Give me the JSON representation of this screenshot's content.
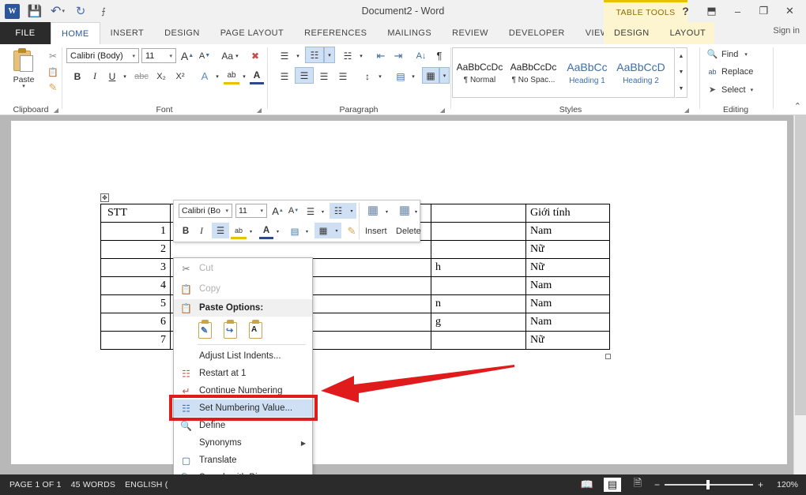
{
  "titlebar": {
    "document_title": "Document2 - Word",
    "quick_access": [
      {
        "name": "word-logo",
        "label": "W"
      },
      {
        "name": "save-icon",
        "label": "💾"
      },
      {
        "name": "undo-icon",
        "label": "↶"
      },
      {
        "name": "redo-icon",
        "label": "↻"
      },
      {
        "name": "customize-qat-icon",
        "label": "⨍"
      }
    ],
    "contextual_tab_title": "TABLE TOOLS",
    "window_buttons": [
      {
        "name": "help-button",
        "label": "?"
      },
      {
        "name": "ribbon-display-options-button",
        "label": "⬒"
      },
      {
        "name": "minimize-button",
        "label": "–"
      },
      {
        "name": "restore-button",
        "label": "❐"
      },
      {
        "name": "close-button",
        "label": "✕"
      }
    ]
  },
  "tabs": {
    "file_label": "FILE",
    "items": [
      {
        "label": "HOME",
        "active": true
      },
      {
        "label": "INSERT",
        "active": false
      },
      {
        "label": "DESIGN",
        "active": false
      },
      {
        "label": "PAGE LAYOUT",
        "active": false
      },
      {
        "label": "REFERENCES",
        "active": false
      },
      {
        "label": "MAILINGS",
        "active": false
      },
      {
        "label": "REVIEW",
        "active": false
      },
      {
        "label": "DEVELOPER",
        "active": false
      },
      {
        "label": "VIEW",
        "active": false
      }
    ],
    "table_tools_tabs": [
      {
        "label": "DESIGN"
      },
      {
        "label": "LAYOUT"
      }
    ],
    "sign_in": "Sign in"
  },
  "ribbon": {
    "groups": [
      {
        "name": "clipboard",
        "label": "Clipboard"
      },
      {
        "name": "font",
        "label": "Font"
      },
      {
        "name": "paragraph",
        "label": "Paragraph"
      },
      {
        "name": "styles",
        "label": "Styles"
      },
      {
        "name": "editing",
        "label": "Editing"
      }
    ],
    "clipboard": {
      "paste_label": "Paste",
      "cut_label": "✂",
      "copy_label": "❐",
      "format_painter_label": "🖌"
    },
    "font": {
      "font_name": "Calibri (Body)",
      "font_size": "11",
      "grow_font": "A",
      "shrink_font": "A",
      "change_case": "Aa",
      "clear_formatting": "🖍",
      "bold": "B",
      "italic": "I",
      "underline": "U",
      "strikethrough": "abc",
      "subscript": "X₂",
      "superscript": "X²",
      "text_effects": "A",
      "highlight": "ab",
      "font_color": "A"
    },
    "paragraph": {
      "bullets": "☰",
      "numbering": "☷",
      "multilevel": "☵",
      "decrease_indent": "⇤",
      "increase_indent": "⇥",
      "sort": "A↓",
      "show_marks": "¶",
      "align_left": "☰",
      "align_center": "☰",
      "align_right": "☰",
      "justify": "☰",
      "line_spacing": "↕",
      "shading": "▤",
      "borders": "▦"
    },
    "styles": {
      "items": [
        {
          "preview": "AaBbCcDc",
          "name": "¶ Normal",
          "heading": false
        },
        {
          "preview": "AaBbCcDc",
          "name": "¶ No Spac...",
          "heading": false
        },
        {
          "preview": "AaBbCс",
          "name": "Heading 1",
          "heading": true
        },
        {
          "preview": "AaBbCcD",
          "name": "Heading 2",
          "heading": true
        }
      ]
    },
    "editing": {
      "find": "Find",
      "replace": "Replace",
      "select": "Select",
      "find_icon": "🔍",
      "replace_icon": "ab",
      "select_icon": "➤"
    },
    "collapse_icon": "⌃"
  },
  "document": {
    "table": {
      "headers": [
        "STT",
        "",
        "",
        "Giới tính"
      ],
      "rows": [
        {
          "stt": "1",
          "name": "",
          "extra": "",
          "sex": "Nam"
        },
        {
          "stt": "2",
          "name": "",
          "extra": "",
          "sex": "Nữ"
        },
        {
          "stt": "3",
          "name": "",
          "extra": "h",
          "sex": "Nữ"
        },
        {
          "stt": "4",
          "name": "",
          "extra": "",
          "sex": "Nam"
        },
        {
          "stt": "5",
          "name": "",
          "extra": "n",
          "sex": "Nam"
        },
        {
          "stt": "6",
          "name": "",
          "extra": "g",
          "sex": "Nam"
        },
        {
          "stt": "7",
          "name": "",
          "extra": "",
          "sex": "Nữ"
        }
      ],
      "move_handle_icon": "✥"
    }
  },
  "minitoolbar": {
    "font_name": "Calibri (Bo",
    "font_size": "11",
    "grow_font": "A",
    "shrink_font": "A",
    "bullets": "☰",
    "numbering": "☷",
    "bold": "B",
    "italic": "I",
    "align": "☰",
    "highlight": "ab",
    "font_color": "A",
    "shading": "▤",
    "borders": "▦",
    "format_painter": "🖌",
    "insert_label": "Insert",
    "delete_label": "Delete"
  },
  "contextmenu": {
    "items": [
      {
        "label": "Cut",
        "icon": "✂",
        "disabled": true,
        "name": "cut"
      },
      {
        "label": "Copy",
        "icon": "❐",
        "disabled": true,
        "name": "copy"
      },
      {
        "label": "Paste Options:",
        "icon": "📋",
        "header": true,
        "name": "paste-options"
      },
      {
        "label": "Adjust List Indents...",
        "icon": "",
        "name": "adjust-list-indents"
      },
      {
        "label": "Restart at 1",
        "icon": "☷",
        "name": "restart-at-1"
      },
      {
        "label": "Continue Numbering",
        "icon": "↵",
        "name": "continue-numbering"
      },
      {
        "label": "Set Numbering Value...",
        "icon": "☷",
        "name": "set-numbering-value",
        "highlighted": true
      },
      {
        "label": "Define",
        "icon": "📘",
        "name": "define"
      },
      {
        "label": "Synonyms",
        "icon": "",
        "submenu": true,
        "name": "synonyms"
      },
      {
        "label": "Translate",
        "icon": "☷",
        "name": "translate"
      },
      {
        "label": "Search with Bing",
        "icon": "🔍",
        "name": "search-with-bing"
      }
    ],
    "submenu_arrow": "▶",
    "paste_option_icons": [
      "keep-source-formatting",
      "merge-formatting",
      "keep-text-only"
    ]
  },
  "annotation": {
    "highlight_color": "#e01b1b",
    "arrow_color": "#e01b1b",
    "target": "Set Numbering Value..."
  },
  "statusbar": {
    "page_info": "PAGE 1 OF 1",
    "word_count": "45 WORDS",
    "language": "ENGLISH (",
    "views": [
      {
        "name": "read-mode-icon",
        "glyph": "📖",
        "active": false
      },
      {
        "name": "print-layout-icon",
        "glyph": "▤",
        "active": true
      },
      {
        "name": "web-layout-icon",
        "glyph": "🗎",
        "active": false
      }
    ],
    "zoom_out": "−",
    "zoom_in": "+",
    "zoom_level": "120%"
  }
}
